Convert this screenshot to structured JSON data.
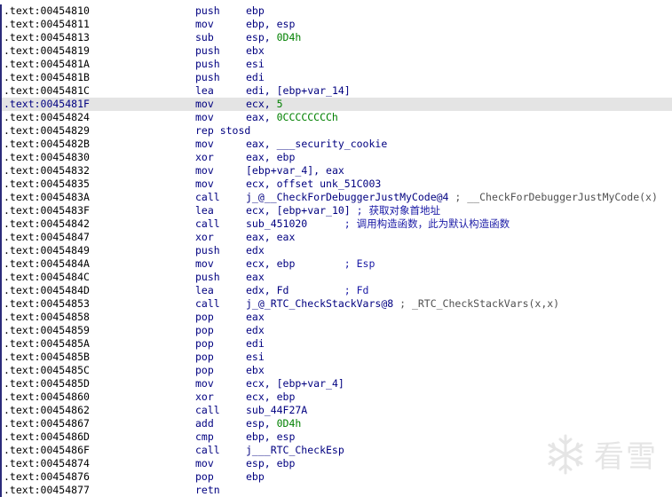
{
  "listing": [
    {
      "addr": ".text:00454810",
      "mnem": "push",
      "ops": [
        {
          "t": "ebp"
        }
      ]
    },
    {
      "addr": ".text:00454811",
      "mnem": "mov",
      "ops": [
        {
          "t": "ebp, esp"
        }
      ]
    },
    {
      "addr": ".text:00454813",
      "mnem": "sub",
      "ops": [
        {
          "t": "esp, "
        },
        {
          "t": "0D4h",
          "c": "num"
        }
      ]
    },
    {
      "addr": ".text:00454819",
      "mnem": "push",
      "ops": [
        {
          "t": "ebx"
        }
      ]
    },
    {
      "addr": ".text:0045481A",
      "mnem": "push",
      "ops": [
        {
          "t": "esi"
        }
      ]
    },
    {
      "addr": ".text:0045481B",
      "mnem": "push",
      "ops": [
        {
          "t": "edi"
        }
      ]
    },
    {
      "addr": ".text:0045481C",
      "mnem": "lea",
      "ops": [
        {
          "t": "edi, [ebp+"
        },
        {
          "t": "var_14",
          "c": "var"
        },
        {
          "t": "]"
        }
      ]
    },
    {
      "addr": ".text:0045481F",
      "mnem": "mov",
      "ops": [
        {
          "t": "ecx, "
        },
        {
          "t": "5",
          "c": "num"
        }
      ],
      "selected": true
    },
    {
      "addr": ".text:00454824",
      "mnem": "mov",
      "ops": [
        {
          "t": "eax, "
        },
        {
          "t": "0CCCCCCCCh",
          "c": "num"
        }
      ]
    },
    {
      "addr": ".text:00454829",
      "mnem": "rep stosd",
      "ops": []
    },
    {
      "addr": ".text:0045482B",
      "mnem": "mov",
      "ops": [
        {
          "t": "eax, "
        },
        {
          "t": "___security_cookie",
          "c": "sym"
        }
      ]
    },
    {
      "addr": ".text:00454830",
      "mnem": "xor",
      "ops": [
        {
          "t": "eax, ebp"
        }
      ]
    },
    {
      "addr": ".text:00454832",
      "mnem": "mov",
      "ops": [
        {
          "t": "[ebp+"
        },
        {
          "t": "var_4",
          "c": "var"
        },
        {
          "t": "], eax"
        }
      ]
    },
    {
      "addr": ".text:00454835",
      "mnem": "mov",
      "ops": [
        {
          "t": "ecx, offset unk_51C003"
        }
      ]
    },
    {
      "addr": ".text:0045483A",
      "mnem": "call",
      "ops": [
        {
          "t": "j_@__CheckForDebuggerJustMyCode@4",
          "c": "sym"
        },
        {
          "t": " ; __CheckForDebuggerJustMyCode(x)",
          "c": "cmt"
        }
      ]
    },
    {
      "addr": ".text:0045483F",
      "mnem": "lea",
      "ops": [
        {
          "t": "ecx, [ebp+"
        },
        {
          "t": "var_10",
          "c": "var"
        },
        {
          "t": "]"
        },
        {
          "t": " ; 获取对象首地址",
          "c": "cmt cn"
        }
      ]
    },
    {
      "addr": ".text:00454842",
      "mnem": "call",
      "ops": [
        {
          "t": "sub_451020"
        },
        {
          "t": "      ; 调用构造函数，此为默认构造函数",
          "c": "cmt cn"
        }
      ]
    },
    {
      "addr": ".text:00454847",
      "mnem": "xor",
      "ops": [
        {
          "t": "eax, eax"
        }
      ]
    },
    {
      "addr": ".text:00454849",
      "mnem": "push",
      "ops": [
        {
          "t": "edx"
        }
      ]
    },
    {
      "addr": ".text:0045484A",
      "mnem": "mov",
      "ops": [
        {
          "t": "ecx, ebp"
        },
        {
          "t": "        ; Esp",
          "c": "cmt cn"
        }
      ]
    },
    {
      "addr": ".text:0045484C",
      "mnem": "push",
      "ops": [
        {
          "t": "eax"
        }
      ]
    },
    {
      "addr": ".text:0045484D",
      "mnem": "lea",
      "ops": [
        {
          "t": "edx, Fd"
        },
        {
          "t": "         ; Fd",
          "c": "cmt cn"
        }
      ]
    },
    {
      "addr": ".text:00454853",
      "mnem": "call",
      "ops": [
        {
          "t": "j_@_RTC_CheckStackVars@8",
          "c": "sym"
        },
        {
          "t": " ; _RTC_CheckStackVars(x,x)",
          "c": "cmt"
        }
      ]
    },
    {
      "addr": ".text:00454858",
      "mnem": "pop",
      "ops": [
        {
          "t": "eax"
        }
      ]
    },
    {
      "addr": ".text:00454859",
      "mnem": "pop",
      "ops": [
        {
          "t": "edx"
        }
      ]
    },
    {
      "addr": ".text:0045485A",
      "mnem": "pop",
      "ops": [
        {
          "t": "edi"
        }
      ]
    },
    {
      "addr": ".text:0045485B",
      "mnem": "pop",
      "ops": [
        {
          "t": "esi"
        }
      ]
    },
    {
      "addr": ".text:0045485C",
      "mnem": "pop",
      "ops": [
        {
          "t": "ebx"
        }
      ]
    },
    {
      "addr": ".text:0045485D",
      "mnem": "mov",
      "ops": [
        {
          "t": "ecx, [ebp+"
        },
        {
          "t": "var_4",
          "c": "var"
        },
        {
          "t": "]"
        }
      ]
    },
    {
      "addr": ".text:00454860",
      "mnem": "xor",
      "ops": [
        {
          "t": "ecx, ebp"
        }
      ]
    },
    {
      "addr": ".text:00454862",
      "mnem": "call",
      "ops": [
        {
          "t": "sub_44F27A"
        }
      ]
    },
    {
      "addr": ".text:00454867",
      "mnem": "add",
      "ops": [
        {
          "t": "esp, "
        },
        {
          "t": "0D4h",
          "c": "num"
        }
      ]
    },
    {
      "addr": ".text:0045486D",
      "mnem": "cmp",
      "ops": [
        {
          "t": "ebp, esp"
        }
      ]
    },
    {
      "addr": ".text:0045486F",
      "mnem": "call",
      "ops": [
        {
          "t": "j___RTC_CheckEsp",
          "c": "sym"
        }
      ]
    },
    {
      "addr": ".text:00454874",
      "mnem": "mov",
      "ops": [
        {
          "t": "esp, ebp"
        }
      ]
    },
    {
      "addr": ".text:00454876",
      "mnem": "pop",
      "ops": [
        {
          "t": "ebp"
        }
      ]
    },
    {
      "addr": ".text:00454877",
      "mnem": "retn",
      "ops": []
    }
  ],
  "watermark": {
    "text": "看雪",
    "icon": "snowflake-icon",
    "color": "#d0d0d0"
  },
  "colors": {
    "code": "#000080",
    "number": "#008000",
    "comment": "#505050",
    "selection": "#e4e4e4"
  }
}
